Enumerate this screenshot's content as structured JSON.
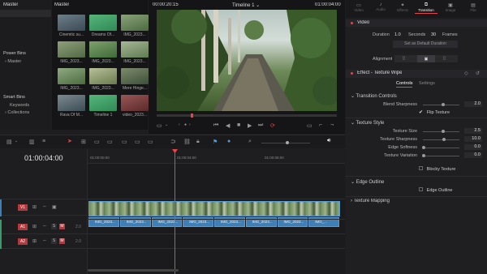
{
  "media_pool": {
    "title": "Master",
    "bins_header": "Master",
    "power_bins_label": "Power Bins",
    "power_bins_item": "Master",
    "smart_bins_label": "Smart Bins",
    "smart_bins_items": [
      "Keywords",
      "Collections"
    ],
    "clips": [
      {
        "label": "Cinemtic su..."
      },
      {
        "label": "Dreams Of..."
      },
      {
        "label": "IMG_2023..."
      },
      {
        "label": "IMG_2023..."
      },
      {
        "label": "IMG_2023..."
      },
      {
        "label": "IMG_2023..."
      },
      {
        "label": "IMG_2023..."
      },
      {
        "label": "IMG_2023..."
      },
      {
        "label": "Mere Hinge..."
      },
      {
        "label": "Rava Of M..."
      },
      {
        "label": "Timeline 1"
      },
      {
        "label": "video_2023..."
      }
    ]
  },
  "viewer": {
    "source_timecode": "00:00:20:15",
    "timeline_name": "Timeline 1",
    "record_timecode": "01:00:04:00"
  },
  "timeline": {
    "current_timecode": "01:00:04:00",
    "ruler_marks": [
      "01:00:00:00",
      "01:00:04:00",
      "01:00:08:00"
    ],
    "tracks": [
      {
        "name": "V1",
        "type": "video"
      },
      {
        "name": "A1",
        "type": "audio",
        "level": "2.0"
      },
      {
        "name": "A2",
        "type": "audio",
        "level": "2.0"
      }
    ],
    "audio_clips": [
      "IMG_2023...",
      "IMG_2023...",
      "IMG_2023...",
      "IMG_2023...",
      "IMG_2023...",
      "IMG_2023...",
      "IMG_2023...",
      "IMG_..."
    ]
  },
  "inspector": {
    "tabs": [
      "Video",
      "Audio",
      "Effects",
      "Transition",
      "Image",
      "File"
    ],
    "active_tab": "Transition",
    "video_section": "Video",
    "duration_label": "Duration",
    "duration_value": "1.0",
    "seconds_label": "Seconds",
    "frames_value": "30",
    "frames_label": "Frames",
    "default_duration_button": "Set as Default Duration",
    "alignment_label": "Alignment",
    "effect_title": "Effect - Texture Wipe",
    "subtabs": [
      "Controls",
      "Settings"
    ],
    "transition_controls_header": "Transition Controls",
    "blend_sharpness_label": "Blend Sharpness",
    "blend_sharpness_value": "2.0",
    "flip_texture_label": "Flip Texture",
    "texture_style_header": "Texture Style",
    "texture_size_label": "Texture Size",
    "texture_size_value": "2.5",
    "texture_sharpness_label": "Texture Sharpness",
    "texture_sharpness_value": "10.0",
    "edge_softness_label": "Edge Softness",
    "edge_softness_value": "0.0",
    "texture_variation_label": "Texture Variation",
    "texture_variation_value": "0.0",
    "blocky_texture_label": "Blocky Texture",
    "edge_outline_header": "Edge Outline",
    "edge_outline_label": "Edge Outline",
    "texture_mapping_header": "Texture Mapping"
  },
  "colors": {
    "accent_red": "#e8444a",
    "clip_blue": "#3d7fb6",
    "playhead": "#e8444a"
  }
}
